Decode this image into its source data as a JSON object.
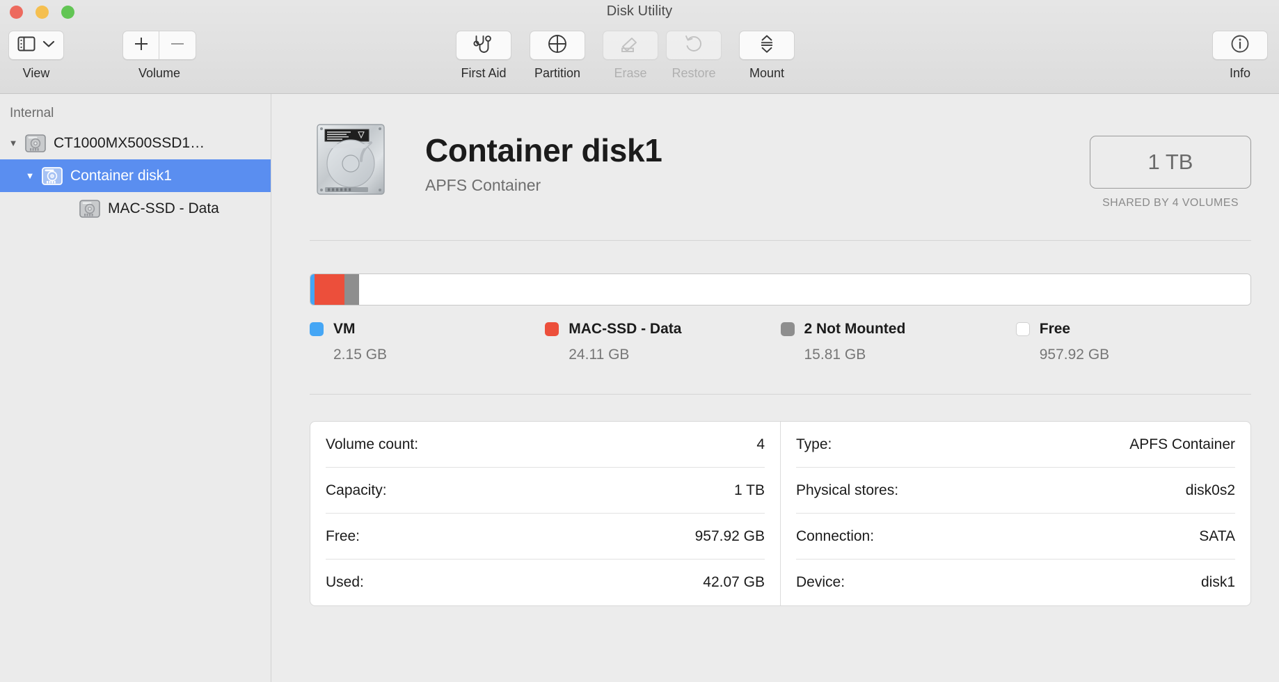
{
  "window": {
    "title": "Disk Utility",
    "traffic_lights": [
      "close",
      "minimize",
      "maximize"
    ]
  },
  "toolbar": {
    "view": {
      "label": "View",
      "icon": "sidebar-icon",
      "chevron": "chevron-down-icon",
      "enabled": true
    },
    "volume": {
      "label": "Volume",
      "add_icon": "plus-icon",
      "remove_icon": "minus-icon",
      "add_enabled": true,
      "remove_enabled": false
    },
    "items": [
      {
        "label": "First Aid",
        "icon": "stethoscope-icon",
        "enabled": true
      },
      {
        "label": "Partition",
        "icon": "pie-chart-icon",
        "enabled": true
      },
      {
        "label": "Erase",
        "icon": "eraser-icon",
        "enabled": false
      },
      {
        "label": "Restore",
        "icon": "undo-arrow-icon",
        "enabled": false
      },
      {
        "label": "Mount",
        "icon": "eject-mount-icon",
        "enabled": true
      }
    ],
    "info": {
      "label": "Info",
      "icon": "info-circle-icon",
      "enabled": true
    }
  },
  "sidebar": {
    "section_header": "Internal",
    "items": [
      {
        "label": "CT1000MX500SSD1…",
        "icon": "disk-icon",
        "indent": 0,
        "expanded": true,
        "selected": false
      },
      {
        "label": "Container disk1",
        "icon": "disk-icon",
        "indent": 1,
        "expanded": true,
        "selected": true
      },
      {
        "label": "MAC-SSD - Data",
        "icon": "disk-icon",
        "indent": 2,
        "expanded": null,
        "selected": false
      }
    ],
    "selection_color": "#5a8ef0"
  },
  "main": {
    "hero": {
      "icon": "hard-drive-icon",
      "title": "Container disk1",
      "subtitle": "APFS Container"
    },
    "capacity": {
      "value": "1 TB",
      "note": "SHARED BY 4 VOLUMES"
    },
    "usage": {
      "segments": [
        {
          "name": "VM",
          "color": "#45a6f5",
          "percent": 0.42
        },
        {
          "name": "MAC-SSD - Data",
          "color": "#ec4f3b",
          "percent": 3.2
        },
        {
          "name": "2 Not Mounted",
          "color": "#8e8e8e",
          "percent": 1.55
        },
        {
          "name": "Free",
          "color": "#ffffff",
          "percent": 94.83
        }
      ]
    },
    "legend": [
      {
        "name": "VM",
        "size": "2.15 GB",
        "color": "#45a6f5"
      },
      {
        "name": "MAC-SSD - Data",
        "size": "24.11 GB",
        "color": "#ec4f3b"
      },
      {
        "name": "2 Not Mounted",
        "size": "15.81 GB",
        "color": "#8e8e8e"
      },
      {
        "name": "Free",
        "size": "957.92 GB",
        "color": "#ffffff"
      }
    ],
    "info_left": [
      {
        "label": "Volume count:",
        "value": "4"
      },
      {
        "label": "Capacity:",
        "value": "1 TB"
      },
      {
        "label": "Free:",
        "value": "957.92 GB"
      },
      {
        "label": "Used:",
        "value": "42.07 GB"
      }
    ],
    "info_right": [
      {
        "label": "Type:",
        "value": "APFS Container"
      },
      {
        "label": "Physical stores:",
        "value": "disk0s2"
      },
      {
        "label": "Connection:",
        "value": "SATA"
      },
      {
        "label": "Device:",
        "value": "disk1"
      }
    ]
  }
}
